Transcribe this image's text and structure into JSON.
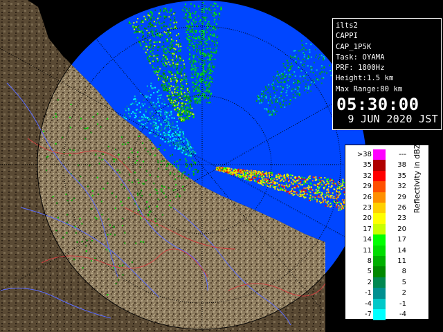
{
  "info": {
    "site": "ilts2",
    "product": "CAPPI",
    "scan": "CAP_1P5K",
    "task": "Task: OYAMA",
    "prf": "PRF: 1800Hz",
    "height": "Height:1.5 km",
    "max_range": "Max Range:80 km",
    "time": "05:30:00",
    "date": "9 JUN 2020 JST"
  },
  "legend": {
    "title": "Reflectivity in dBZ",
    "rows": [
      {
        "left": ">38",
        "right": "---",
        "color": "#ff00ff"
      },
      {
        "left": "35",
        "right": "38",
        "color": "#b00000"
      },
      {
        "left": "32",
        "right": "35",
        "color": "#ff0000"
      },
      {
        "left": "29",
        "right": "32",
        "color": "#ff5000"
      },
      {
        "left": "26",
        "right": "29",
        "color": "#ff9000"
      },
      {
        "left": "23",
        "right": "26",
        "color": "#ffd000"
      },
      {
        "left": "20",
        "right": "23",
        "color": "#ffff00"
      },
      {
        "left": "17",
        "right": "20",
        "color": "#c8ff00"
      },
      {
        "left": "14",
        "right": "17",
        "color": "#00ff00"
      },
      {
        "left": "11",
        "right": "14",
        "color": "#00dd00"
      },
      {
        "left": "8",
        "right": "11",
        "color": "#00b000"
      },
      {
        "left": "5",
        "right": "8",
        "color": "#008800"
      },
      {
        "left": "2",
        "right": "5",
        "color": "#008850"
      },
      {
        "left": "-1",
        "right": "2",
        "color": "#009090"
      },
      {
        "left": "-4",
        "right": "-1",
        "color": "#00c8c8"
      },
      {
        "left": "-7",
        "right": "-4",
        "color": "#00ffff"
      }
    ]
  },
  "colors": {
    "water": "#0046ff",
    "land": "#8a7a5e",
    "range_ring": "#000000"
  }
}
